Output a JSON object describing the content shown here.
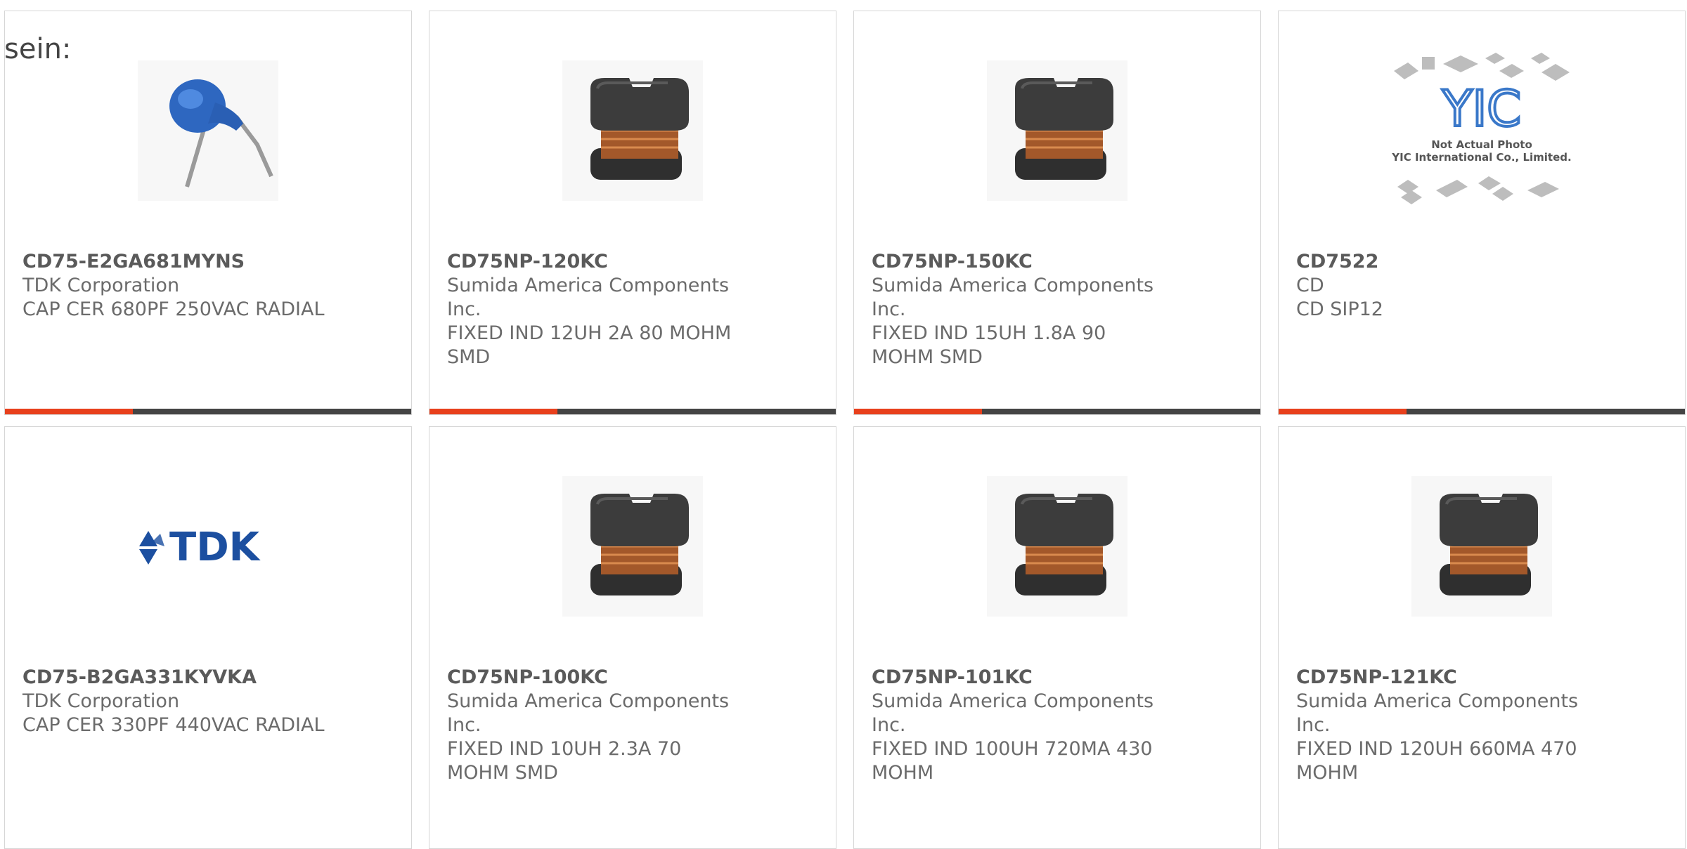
{
  "page": {
    "top_label": "sein:"
  },
  "accent_color": "#e8401c",
  "bar_color": "#444444",
  "products": [
    {
      "part_number": "CD75-E2GA681MYNS",
      "manufacturer": "TDK Corporation",
      "description": "CAP CER 680PF 250VAC RADIAL",
      "image": "ceramic-capacitor-photo"
    },
    {
      "part_number": "CD75NP-120KC",
      "manufacturer": "Sumida America Components Inc.",
      "description": "FIXED IND 12UH 2A 80 MOHM SMD",
      "image": "smd-inductor-photo"
    },
    {
      "part_number": "CD75NP-150KC",
      "manufacturer": "Sumida America Components Inc.",
      "description": "FIXED IND 15UH 1.8A 90 MOHM SMD",
      "image": "smd-inductor-photo"
    },
    {
      "part_number": "CD7522",
      "manufacturer": "CD",
      "description": "CD SIP12",
      "image": "yic-placeholder",
      "image_text": {
        "logo": "YIC",
        "line1": "Not Actual Photo",
        "line2": "YIC International Co., Limited."
      }
    },
    {
      "part_number": "CD75-B2GA331KYVKA",
      "manufacturer": "TDK Corporation",
      "description": "CAP CER 330PF 440VAC RADIAL",
      "image": "tdk-logo",
      "image_text": {
        "logo": "TDK"
      }
    },
    {
      "part_number": "CD75NP-100KC",
      "manufacturer": "Sumida America Components Inc.",
      "description": "FIXED IND 10UH 2.3A 70 MOHM SMD",
      "image": "smd-inductor-photo"
    },
    {
      "part_number": "CD75NP-101KC",
      "manufacturer": "Sumida America Components Inc.",
      "description": "FIXED IND 100UH 720MA 430 MOHM",
      "image": "smd-inductor-photo"
    },
    {
      "part_number": "CD75NP-121KC",
      "manufacturer": "Sumida America Components Inc.",
      "description": "FIXED IND 120UH 660MA 470 MOHM",
      "image": "smd-inductor-photo"
    }
  ]
}
